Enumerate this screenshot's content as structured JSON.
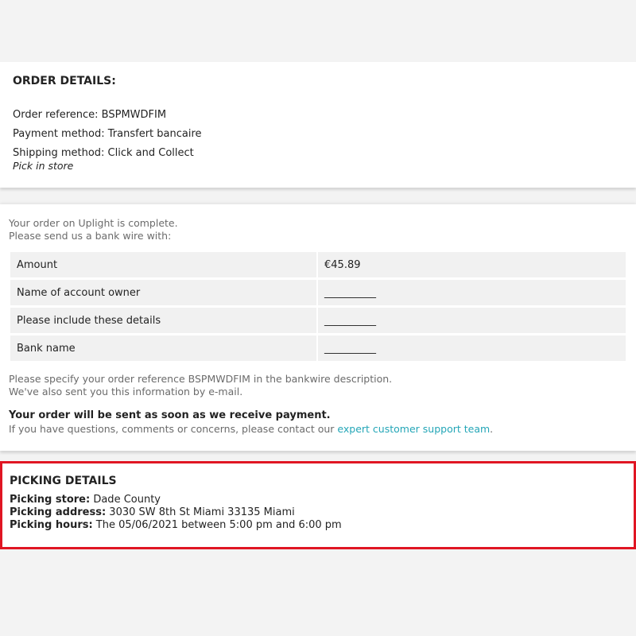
{
  "order_details": {
    "heading": "ORDER DETAILS:",
    "reference": "Order reference: BSPMWDFIM",
    "payment_method": "Payment method: Transfert bancaire",
    "shipping_method": "Shipping method: Click and Collect",
    "shipping_sub": "Pick in store"
  },
  "payment": {
    "intro_1": "Your order on Uplight is complete.",
    "intro_2": "Please send us a bank wire with:",
    "rows": [
      {
        "label": "Amount",
        "value": "€45.89"
      },
      {
        "label": "Name of account owner",
        "value": "__________"
      },
      {
        "label": "Please include these details",
        "value": "__________"
      },
      {
        "label": "Bank name",
        "value": "__________"
      }
    ],
    "note_1": "Please specify your order reference BSPMWDFIM in the bankwire description.",
    "note_2": "We've also sent you this information by e-mail.",
    "send_notice": "Your order will be sent as soon as we receive payment.",
    "contact_prefix": "If you have questions, comments or concerns, please contact our ",
    "contact_link": "expert customer support team",
    "contact_suffix": "."
  },
  "picking": {
    "heading": "PICKING DETAILS",
    "store_label": "Picking store:",
    "store_value": " Dade County",
    "address_label": "Picking address:",
    "address_value": " 3030 SW 8th St Miami 33135 Miami",
    "hours_label": "Picking hours:",
    "hours_value": " The 05/06/2021 between 5:00 pm and 6:00 pm"
  },
  "colors": {
    "link": "#24a6b7",
    "highlight_border": "#e01523"
  }
}
